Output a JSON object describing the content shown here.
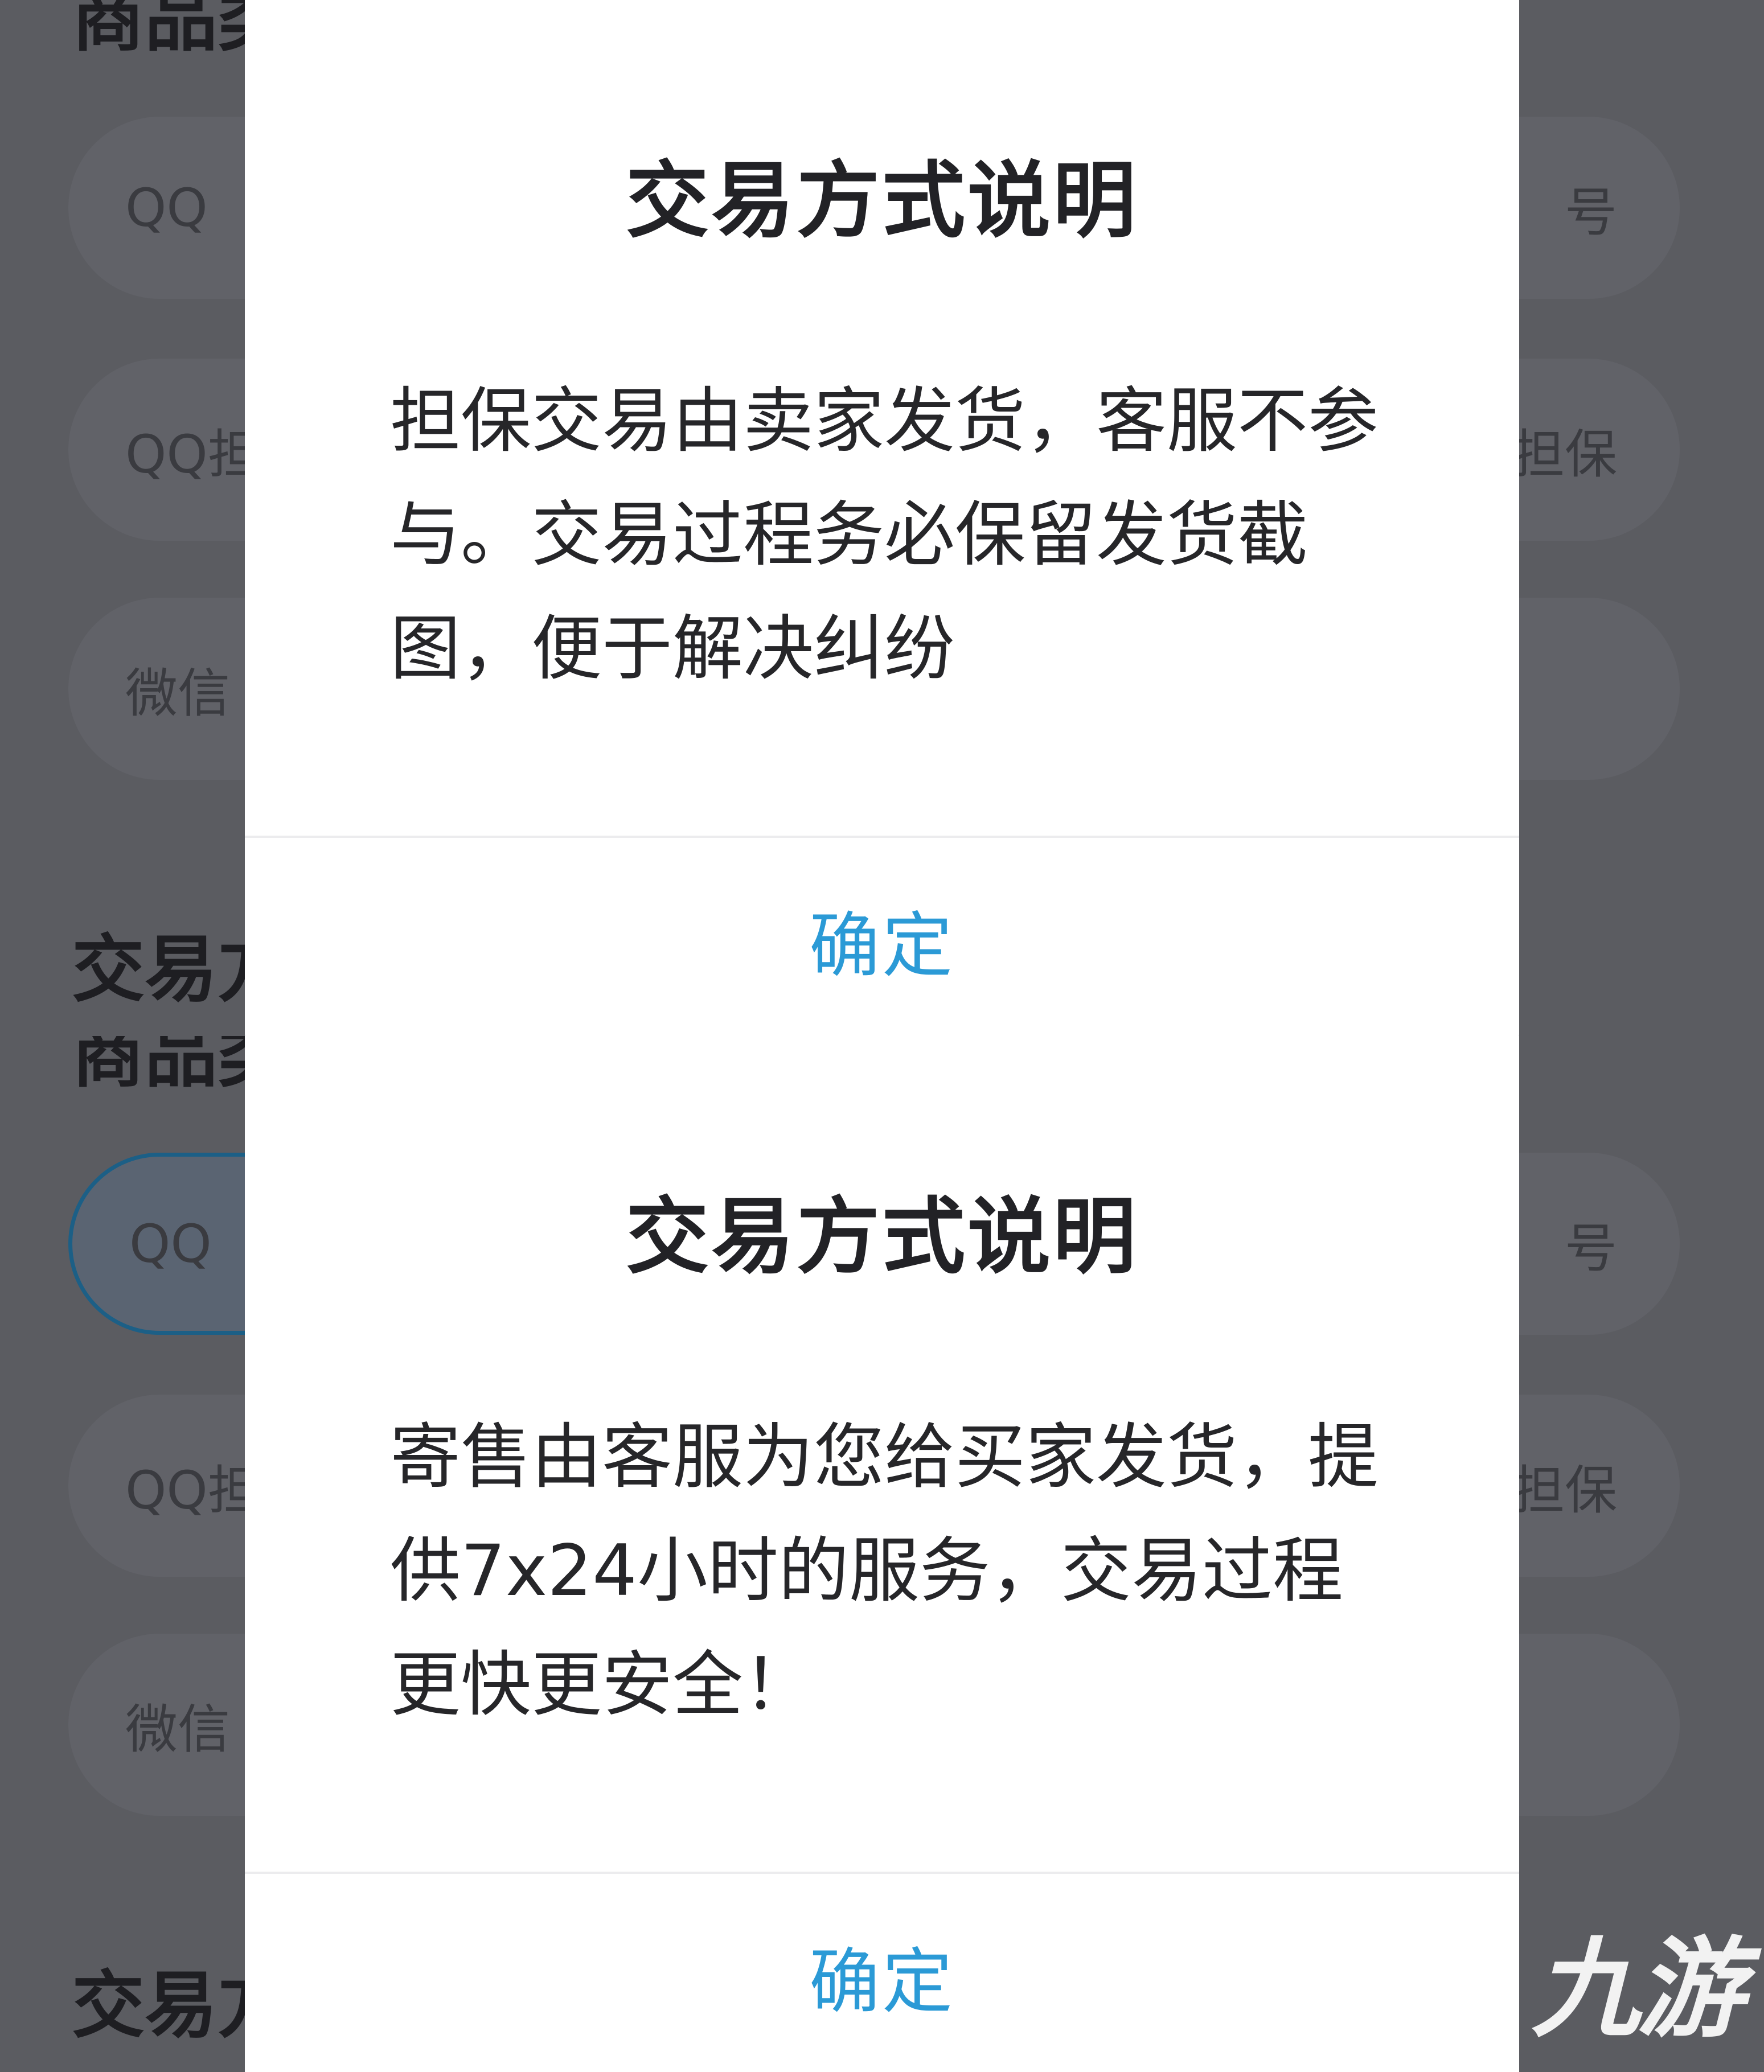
{
  "screens": [
    {
      "background": {
        "category_title": "商品类",
        "trade_title": "交易方",
        "left_options": [
          "QQ",
          "QQ担保",
          "微信"
        ],
        "right_options": [
          "号",
          "担保",
          ""
        ]
      },
      "dialog": {
        "title": "交易方式说明",
        "body": "担保交易由卖家发货，客服不参与。交易过程务必保留发货截图，便于解决纠纷",
        "confirm": "确定"
      }
    },
    {
      "background": {
        "category_title": "商品类",
        "trade_title": "交易方",
        "left_options": [
          "QQ",
          "QQ担保",
          "微信"
        ],
        "right_options": [
          "号",
          "担保",
          ""
        ]
      },
      "dialog": {
        "title": "交易方式说明",
        "body": "寄售由客服为您给买家发货，提供7x24小时的服务，交易过程更快更安全！",
        "confirm": "确定"
      }
    }
  ],
  "watermark": {
    "text": "九游",
    "color": "#ffffff"
  },
  "colors": {
    "overlay": "#5b5c61",
    "dialog_bg": "#ffffff",
    "confirm_text": "#2b9ad6",
    "selected_border": "#1c5f86"
  }
}
